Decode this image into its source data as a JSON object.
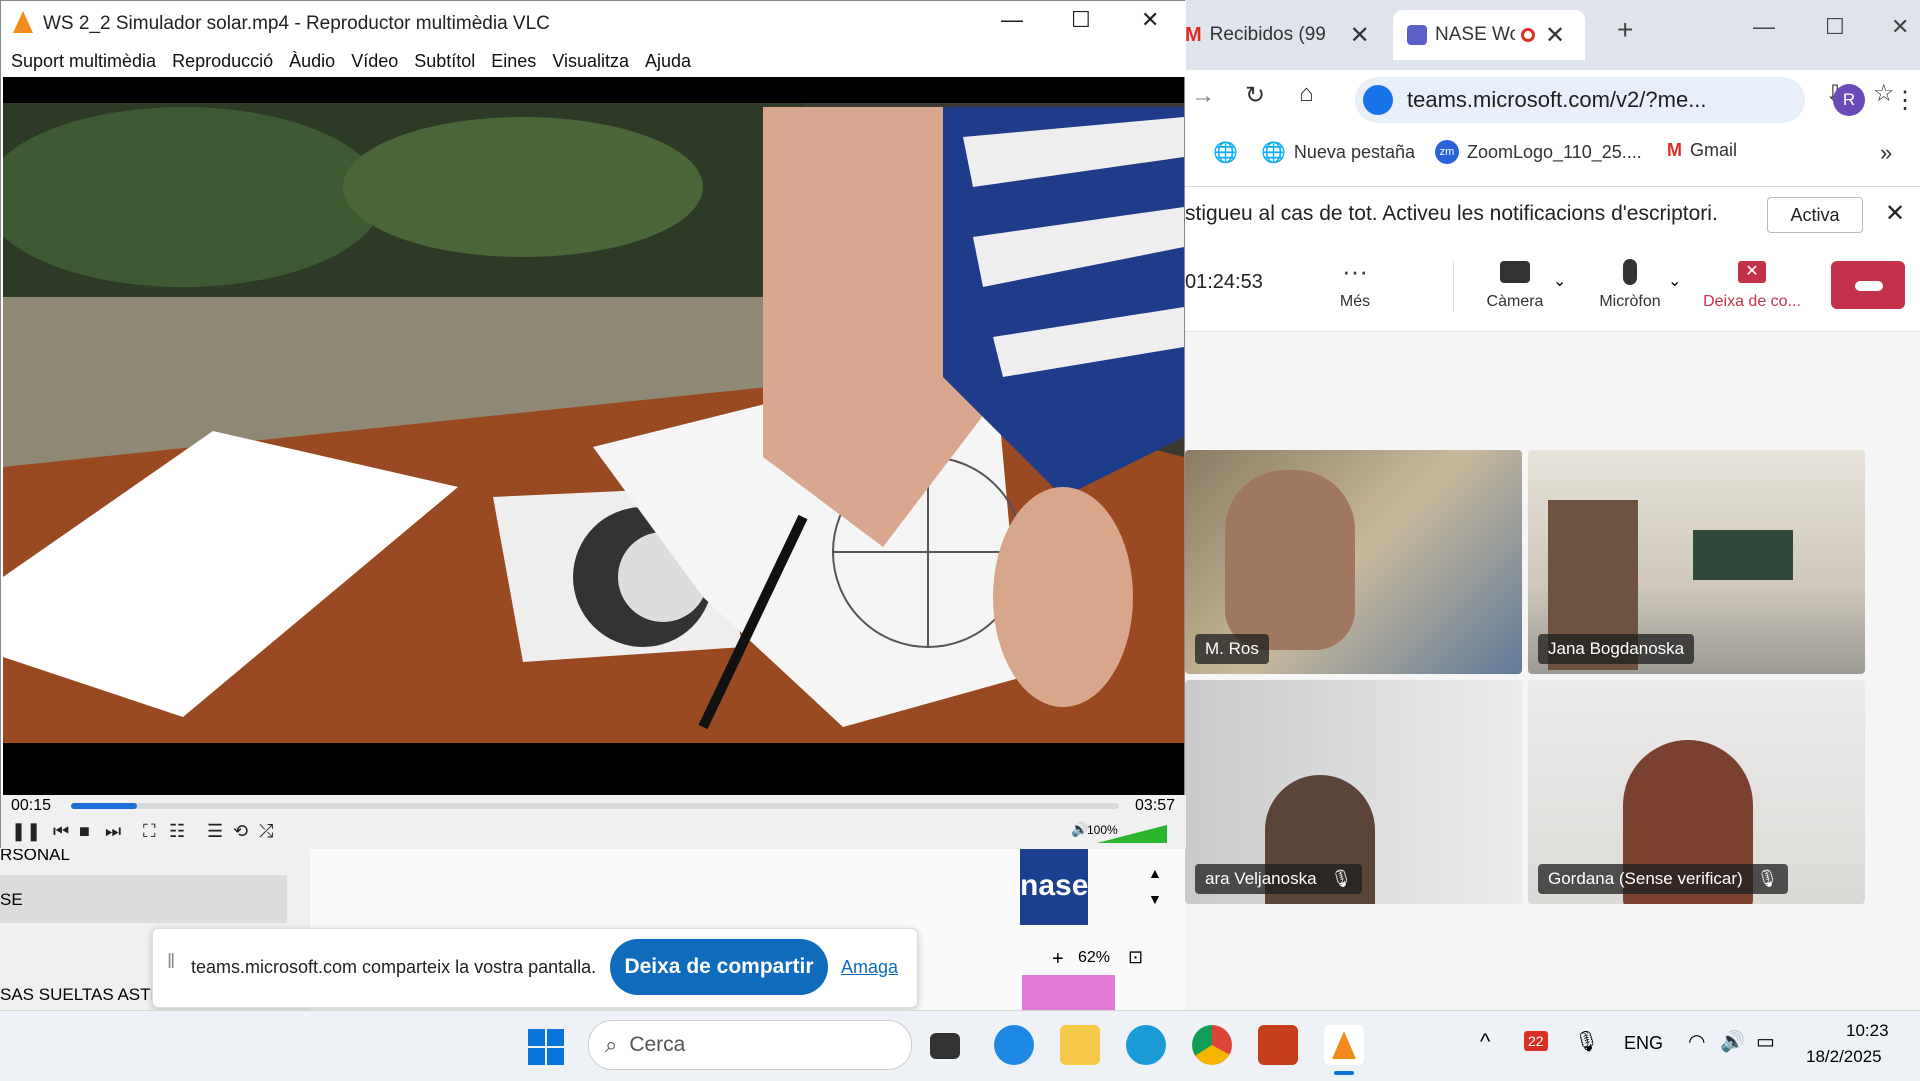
{
  "vlc": {
    "title": "WS 2_2 Simulador solar.mp4 - Reproductor multimèdia VLC",
    "menu": [
      "Suport multimèdia",
      "Reproducció",
      "Àudio",
      "Vídeo",
      "Subtítol",
      "Eines",
      "Visualitza",
      "Ajuda"
    ],
    "time_elapsed": "00:15",
    "time_total": "03:57",
    "progress": 0.063,
    "volume": "100%"
  },
  "chrome": {
    "tabs": [
      {
        "title": "Recibidos (99"
      },
      {
        "title": "NASE Wo"
      }
    ],
    "url": "teams.microsoft.com/v2/?me...",
    "avatar_letter": "R",
    "bookmarks": [
      "Nueva pestaña",
      "ZoomLogo_110_25....",
      "Gmail"
    ],
    "bookmark_zoom_badge": "zm"
  },
  "teams": {
    "notification": "stigueu al cas de tot. Activeu les notificacions d'escriptori.",
    "notification_button": "Activa",
    "timer": "01:24:53",
    "controls": {
      "more": "Més",
      "camera": "Càmera",
      "mic": "Micròfon",
      "stop_share": "Deixa de co..."
    },
    "participants": [
      {
        "name": "M. Ros"
      },
      {
        "name": "Jana Bogdanoska"
      },
      {
        "name": "ara Veljanoska"
      },
      {
        "name": "Gordana (Sense verificar)"
      }
    ]
  },
  "underlying": {
    "items": [
      "RSONAL",
      "SE",
      "SAS SUELTAS ASTRONOMIA"
    ],
    "zoom": "62%",
    "logo_text": "nase",
    "share_text": "teams.microsoft.com comparteix la vostra pantalla.",
    "stop_share": "Deixa de compartir",
    "hide": "Amaga"
  },
  "taskbar": {
    "search": "Cerca",
    "lang": "ENG",
    "time": "10:23",
    "date": "18/2/2025",
    "calendar_day": "22"
  },
  "colors": {
    "accent": "#1e6fd9",
    "teams_purple": "#5b5fc7",
    "hangup_red": "#c4314b",
    "share_blue": "#0f6cbd"
  }
}
